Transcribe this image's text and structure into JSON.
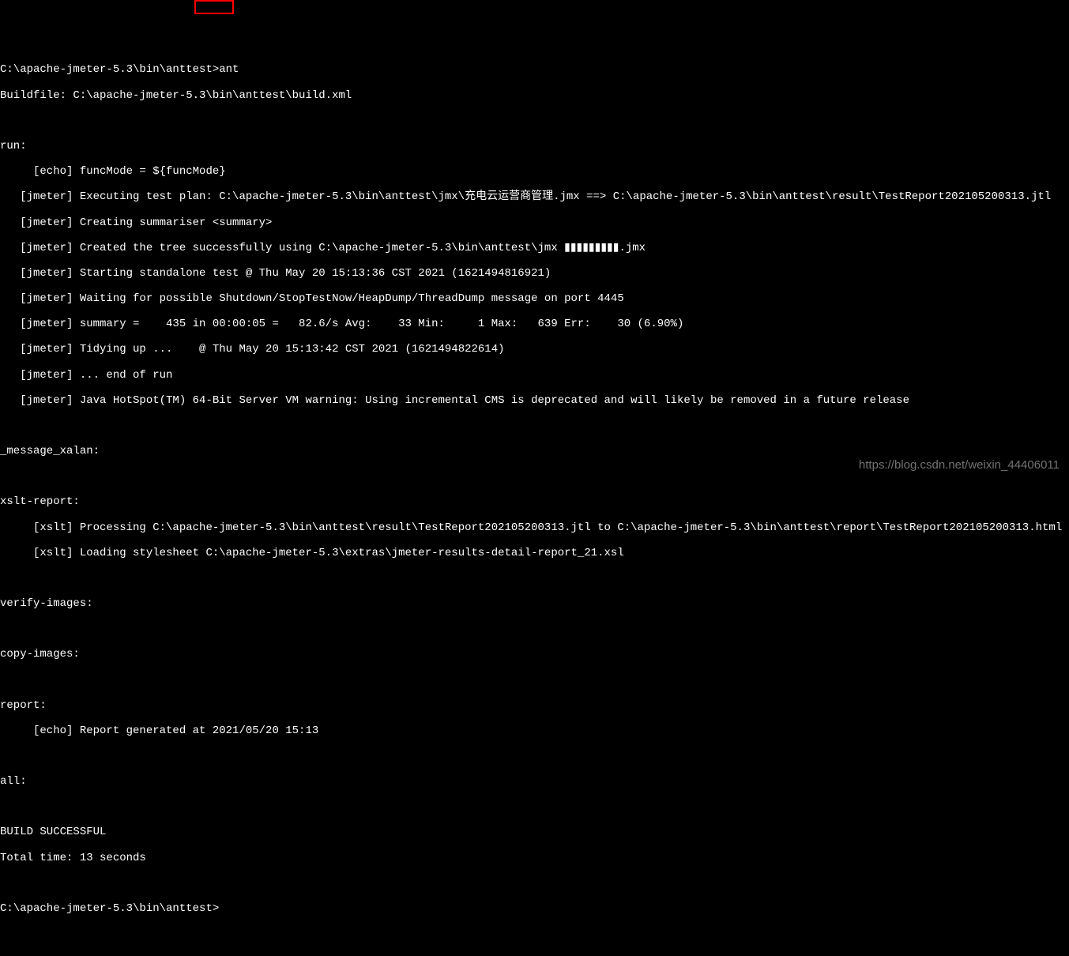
{
  "prompt1": {
    "path": "C:\\apache-jmeter-5.3\\bin\\anttest",
    "command": ">ant"
  },
  "buildfile": "Buildfile: C:\\apache-jmeter-5.3\\bin\\anttest\\build.xml",
  "blank1": "",
  "run_header": "run:",
  "echo1": "     [echo] funcMode = ${funcMode}",
  "jmeter1": "   [jmeter] Executing test plan: C:\\apache-jmeter-5.3\\bin\\anttest\\jmx\\充电云运营商管理.jmx ==> C:\\apache-jmeter-5.3\\bin\\anttest\\result\\TestReport202105200313.jtl",
  "jmeter2": "   [jmeter] Creating summariser <summary>",
  "jmeter3": "   [jmeter] Created the tree successfully using C:\\apache-jmeter-5.3\\bin\\anttest\\jmx ▮▮▮▮▮▮▮▮▮.jmx",
  "jmeter4": "   [jmeter] Starting standalone test @ Thu May 20 15:13:36 CST 2021 (1621494816921)",
  "jmeter5": "   [jmeter] Waiting for possible Shutdown/StopTestNow/HeapDump/ThreadDump message on port 4445",
  "jmeter6": "   [jmeter] summary =    435 in 00:00:05 =   82.6/s Avg:    33 Min:     1 Max:   639 Err:    30 (6.90%)",
  "jmeter7": "   [jmeter] Tidying up ...    @ Thu May 20 15:13:42 CST 2021 (1621494822614)",
  "jmeter8": "   [jmeter] ... end of run",
  "jmeter9": "   [jmeter] Java HotSpot(TM) 64-Bit Server VM warning: Using incremental CMS is deprecated and will likely be removed in a future release",
  "blank2": "",
  "msg_xalan": "_message_xalan:",
  "blank3": "",
  "xslt_header": "xslt-report:",
  "xslt1": "     [xslt] Processing C:\\apache-jmeter-5.3\\bin\\anttest\\result\\TestReport202105200313.jtl to C:\\apache-jmeter-5.3\\bin\\anttest\\report\\TestReport202105200313.html",
  "xslt2": "     [xslt] Loading stylesheet C:\\apache-jmeter-5.3\\extras\\jmeter-results-detail-report_21.xsl",
  "blank4": "",
  "verify_images": "verify-images:",
  "blank5": "",
  "copy_images": "copy-images:",
  "blank6": "",
  "report_header": "report:",
  "report_echo": "     [echo] Report generated at 2021/05/20 15:13",
  "blank7": "",
  "all_header": "all:",
  "blank8": "",
  "build_success": "BUILD SUCCESSFUL",
  "total_time": "Total time: 13 seconds",
  "blank9": "",
  "prompt2": "C:\\apache-jmeter-5.3\\bin\\anttest>",
  "watermark": "https://blog.csdn.net/weixin_44406011"
}
